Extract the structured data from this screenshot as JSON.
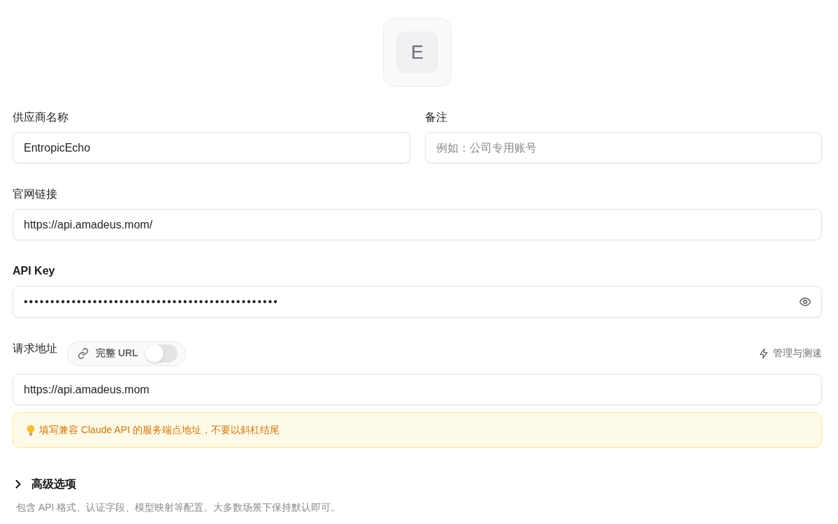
{
  "logo": {
    "letter": "E"
  },
  "provider_name": {
    "label": "供应商名称",
    "value": "EntropicEcho"
  },
  "note": {
    "label": "备注",
    "placeholder": "例如：公司专用账号"
  },
  "website": {
    "label": "官网链接",
    "value": "https://api.amadeus.mom/"
  },
  "api_key": {
    "label": "API Key",
    "value": "••••••••••••••••••••••••••••••••••••••••••••••••"
  },
  "endpoint": {
    "label": "请求地址",
    "full_url_toggle": {
      "label": "完整 URL",
      "on": false
    },
    "manage_link": "管理与测速",
    "value": "https://api.amadeus.mom",
    "hint": "填写兼容 Claude API 的服务端点地址，不要以斜杠结尾"
  },
  "advanced": {
    "title": "高级选项",
    "expanded": false,
    "description": "包含 API 格式、认证字段、模型映射等配置。大多数场景下保持默认即可。"
  }
}
